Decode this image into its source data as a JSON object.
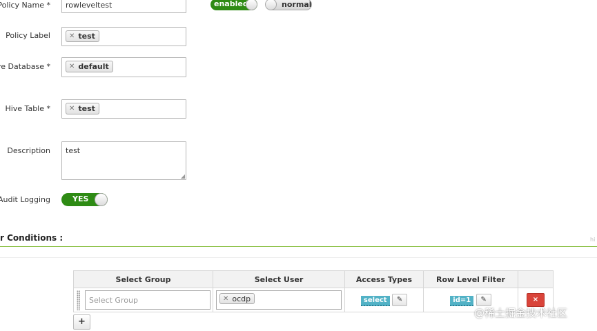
{
  "form": {
    "policy_name": {
      "label": "Policy Name *",
      "value": "rowleveltest"
    },
    "status_toggle": {
      "label": "enabled"
    },
    "type_toggle": {
      "label": "normal"
    },
    "policy_label": {
      "label": "Policy Label",
      "tokens": [
        "test"
      ]
    },
    "hive_database": {
      "label": "ive Database *",
      "tokens": [
        "default"
      ]
    },
    "hive_table": {
      "label": "Hive Table *",
      "tokens": [
        "test"
      ]
    },
    "description": {
      "label": "Description",
      "value": "test"
    },
    "audit_logging": {
      "label": "Audit Logging",
      "toggle_label": "YES"
    }
  },
  "conditions": {
    "title": "r Conditions :",
    "corner_text": "hi",
    "headers": [
      "Select Group",
      "Select User",
      "Access Types",
      "Row Level Filter"
    ],
    "row": {
      "group_placeholder": "Select Group",
      "user_tokens": [
        "ocdp"
      ],
      "access_type": "select",
      "row_filter": "id=1"
    },
    "add_button": "+",
    "delete_icon": "×",
    "edit_icon": "pencil-icon"
  },
  "watermark": "@稀土掘金技术社区",
  "colors": {
    "toggle_green": "#2e8b14",
    "badge_blue": "#52b2c6",
    "delete_red": "#d9443a",
    "section_line": "#8fc34a"
  }
}
